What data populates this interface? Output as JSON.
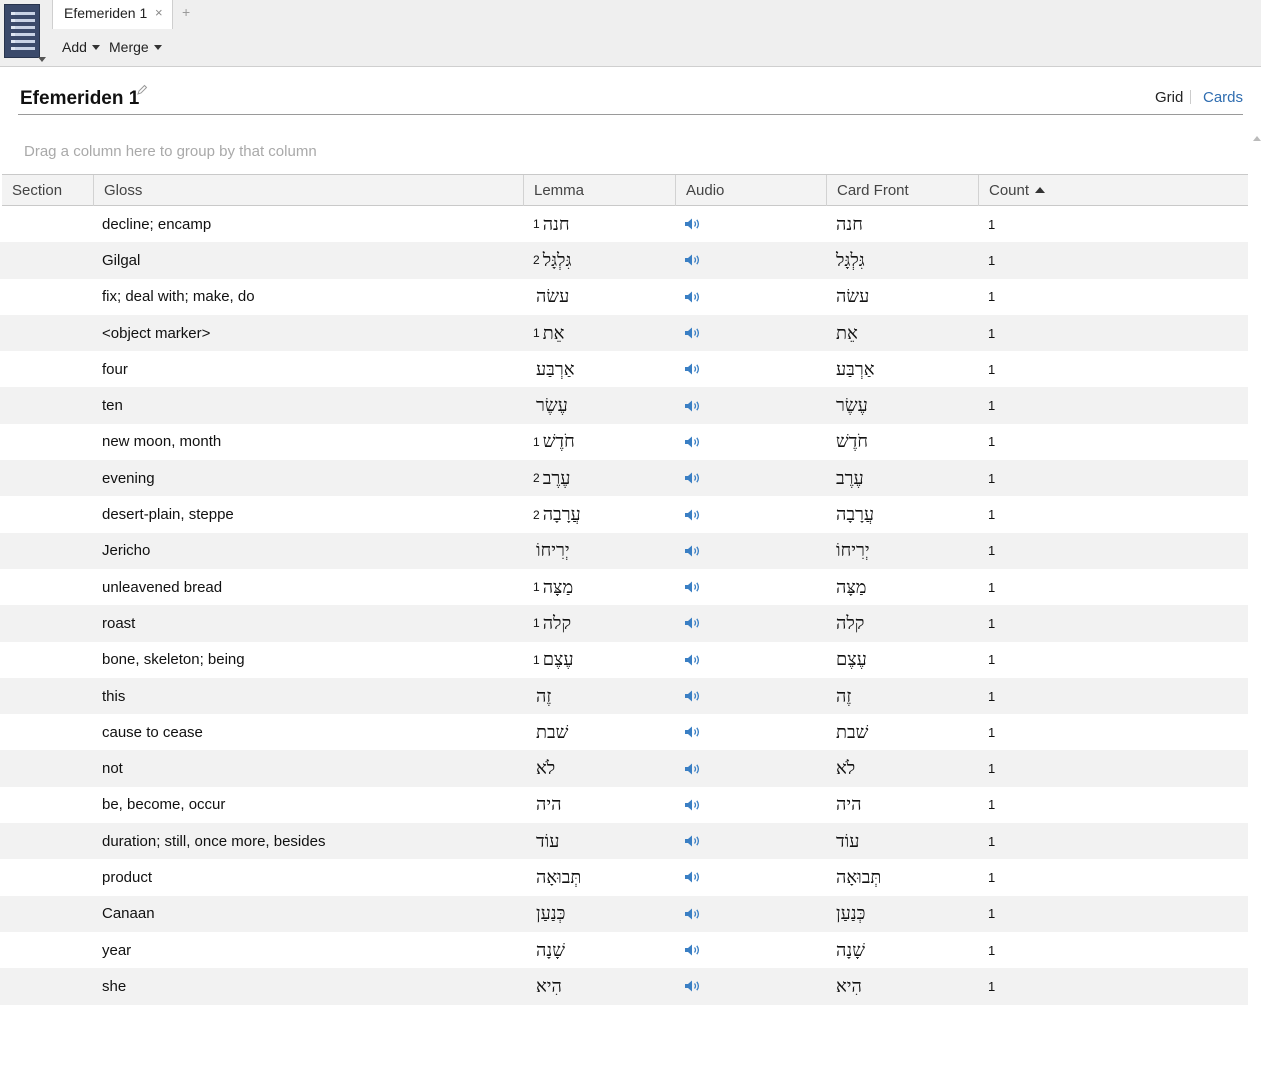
{
  "window": {
    "tab_label": "Efemeriden 1",
    "tab_close": "×",
    "tab_add": "+",
    "icons": {
      "app_menu": "list-menu-icon",
      "audio": "speaker-icon",
      "edit": "pencil-icon"
    }
  },
  "toolbar": {
    "add_label": "Add",
    "merge_label": "Merge"
  },
  "header": {
    "title": "Efemeriden 1",
    "view_grid": "Grid",
    "view_cards": "Cards",
    "active_view_color": "#2f6db0"
  },
  "group_hint": "Drag a column here to group by that column",
  "columns": [
    "Section",
    "Gloss",
    "Lemma",
    "Audio",
    "Card Front",
    "Count"
  ],
  "sort": {
    "column": "Count",
    "direction": "ascending"
  },
  "rows": [
    {
      "gloss": "decline; encamp",
      "lemma_num": "1",
      "lemma": "חנה",
      "front": "חנה",
      "count": "1"
    },
    {
      "gloss": "Gilgal",
      "lemma_num": "2",
      "lemma": "גִּלְגָּל",
      "front": "גִּלְגָּל",
      "count": "1"
    },
    {
      "gloss": "fix; deal with; make, do",
      "lemma_num": "",
      "lemma": "עשׂה",
      "front": "עשׂה",
      "count": "1"
    },
    {
      "gloss": "<object marker>",
      "lemma_num": "1",
      "lemma": "אֵת",
      "front": "אֵת",
      "count": "1"
    },
    {
      "gloss": "four",
      "lemma_num": "",
      "lemma": "אַרְבַּע",
      "front": "אַרְבַּע",
      "count": "1"
    },
    {
      "gloss": "ten",
      "lemma_num": "",
      "lemma": "עֶשֶׂר",
      "front": "עֶשֶׂר",
      "count": "1"
    },
    {
      "gloss": "new moon, month",
      "lemma_num": "1",
      "lemma": "חֹדֶשׁ",
      "front": "חֹדֶשׁ",
      "count": "1"
    },
    {
      "gloss": "evening",
      "lemma_num": "2",
      "lemma": "עֶרֶב",
      "front": "עֶרֶב",
      "count": "1"
    },
    {
      "gloss": "desert-plain, steppe",
      "lemma_num": "2",
      "lemma": "עֲרָבָה",
      "front": "עֲרָבָה",
      "count": "1"
    },
    {
      "gloss": "Jericho",
      "lemma_num": "",
      "lemma": "יְרִיחוֹ",
      "front": "יְרִיחוֹ",
      "count": "1"
    },
    {
      "gloss": "unleavened bread",
      "lemma_num": "1",
      "lemma": "מַצָּה",
      "front": "מַצָּה",
      "count": "1"
    },
    {
      "gloss": "roast",
      "lemma_num": "1",
      "lemma": "קלה",
      "front": "קלה",
      "count": "1"
    },
    {
      "gloss": "bone, skeleton; being",
      "lemma_num": "1",
      "lemma": "עֶצֶם",
      "front": "עֶצֶם",
      "count": "1"
    },
    {
      "gloss": "this",
      "lemma_num": "",
      "lemma": "זֶה",
      "front": "זֶה",
      "count": "1"
    },
    {
      "gloss": "cause to cease",
      "lemma_num": "",
      "lemma": "שׁבת",
      "front": "שׁבת",
      "count": "1"
    },
    {
      "gloss": "not",
      "lemma_num": "",
      "lemma": "לֹא",
      "front": "לֹא",
      "count": "1"
    },
    {
      "gloss": "be, become, occur",
      "lemma_num": "",
      "lemma": "היה",
      "front": "היה",
      "count": "1"
    },
    {
      "gloss": "duration; still, once more, besides",
      "lemma_num": "",
      "lemma": "עוֹד",
      "front": "עוֹד",
      "count": "1"
    },
    {
      "gloss": "product",
      "lemma_num": "",
      "lemma": "תְּבוּאָה",
      "front": "תְּבוּאָה",
      "count": "1"
    },
    {
      "gloss": "Canaan",
      "lemma_num": "",
      "lemma": "כְּנַעַן",
      "front": "כְּנַעַן",
      "count": "1"
    },
    {
      "gloss": "year",
      "lemma_num": "",
      "lemma": "שָׁנָה",
      "front": "שָׁנָה",
      "count": "1"
    },
    {
      "gloss": "she",
      "lemma_num": "",
      "lemma": "הִיא",
      "front": "הִיא",
      "count": "1"
    }
  ]
}
